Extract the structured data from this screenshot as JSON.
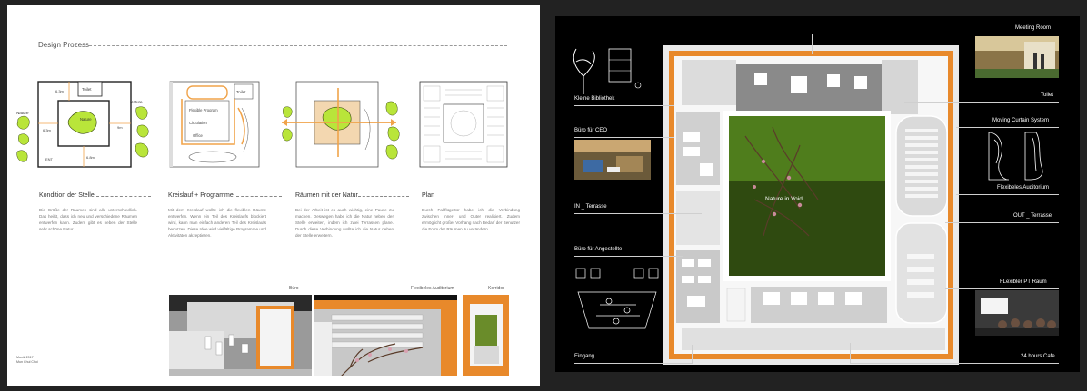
{
  "left_page": {
    "section_title": "Design Prozess",
    "diagram1": {
      "toilet": "Toilet",
      "dim_top": "6.3m",
      "nature_left": "Nature",
      "nature_right": "Nature",
      "nature_center": "Nature",
      "dim_left": "6.3m",
      "dim_right": "9m",
      "ent": "ENT",
      "dim_bottom": "6.8m"
    },
    "diagram2": {
      "toilet": "Toilet",
      "flexible_program": "Flexible Program",
      "circulation": "Circulation",
      "office": "Office"
    },
    "conditions": [
      {
        "title": "Kondition der Stelle",
        "text": "Die Größe der Räumen sind alle unterschiedlich. Das heißt, dass ich neu und verschiedene Räumen entwerfen kann. Zudem gibt es neben der Stelle sehr schöne Natur."
      },
      {
        "title": "Kreislauf + Programme",
        "text": "Mit dem Kreislauf wollte ich die flexiblen Räume entwerfen. Wenn ein Teil des Kreislaufs blockiert wird, kann man einfach anderen Teil des Kreislaufs benutzen. Diese Idee wird vielfältige Programme und Aktivitäten akzeptieren."
      },
      {
        "title": "Räumen mit der Natur",
        "text": "Bei der Arbeit ist es auch wichtig, eine Pause zu machen. Deswegen habe ich die Natur neben der Stelle erweitert, indem ich zwei Terrassen plane. Durch diese Verbindung wollte ich die Natur neben der Stelle erweitern."
      },
      {
        "title": "Plan",
        "text": "Durch Faltflügeltür habe ich die Verbindung zwischen Inner- und Outer realisiert. Zudem ermöglicht großer Vorhang nach Bedarf der Benutzer die Form der Räumen zu verändern."
      }
    ],
    "photos": [
      {
        "label": "Büro"
      },
      {
        "label": "Flexibeles Auditorium"
      },
      {
        "label": "Korridor"
      }
    ],
    "credit": [
      "Munik 2017",
      "Mun Chul Choi"
    ]
  },
  "right_page": {
    "center_label": "Nature in Void",
    "callouts_left": [
      "Kleine Bibliothek",
      "Büro für CEO",
      "IN _ Terrasse",
      "Büro für Angestellte",
      "Eingang"
    ],
    "callouts_right": [
      "Meeting Room",
      "Toilet",
      "Moving Curtain System",
      "Flexibeles Auditorium",
      "OUT _ Terrasse",
      "FLexibler PT Raum",
      "24 hours Cafe"
    ]
  },
  "colors": {
    "nature_green": "#b9e53a",
    "circulation_orange": "#f0a34a",
    "model_orange": "#e8892b",
    "grass_green": "#4f7d1c"
  }
}
